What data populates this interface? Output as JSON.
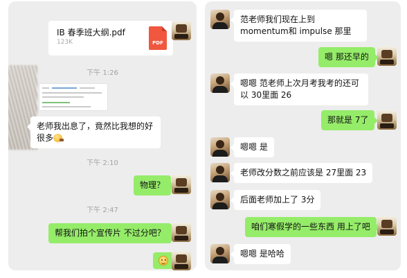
{
  "left_chat": {
    "file_card": {
      "name": "IB 春季班大纲.pdf",
      "size": "123K",
      "icon_label": "PDF"
    },
    "timestamps": [
      "下午 1:26",
      "下午 2:10",
      "下午 2:47"
    ],
    "messages": [
      {
        "sender": "teacher",
        "text": "老师我出息了，竟然比我想的好很多"
      },
      {
        "sender": "me",
        "text": "物理？"
      },
      {
        "sender": "me",
        "text": "帮我们拍个宣传片 不过分吧？"
      },
      {
        "sender": "me",
        "emoji": "smiley-emoji"
      }
    ]
  },
  "right_chat": {
    "messages": [
      {
        "sender": "teacher",
        "text": "范老师我们现在上到 momentum和 impulse 那里"
      },
      {
        "sender": "me",
        "text": "嗯 那还早的"
      },
      {
        "sender": "teacher",
        "text": "嗯嗯 范老师上次月考我考的还可以 30里面 26"
      },
      {
        "sender": "me",
        "text": "那就是 7了"
      },
      {
        "sender": "teacher",
        "text": "嗯嗯 是"
      },
      {
        "sender": "teacher",
        "text": "老师改分数之前应该是 27里面 23"
      },
      {
        "sender": "teacher",
        "text": "后面老师加上了 3分"
      },
      {
        "sender": "me",
        "text": "咱们寒假学的一些东西 用上了吧"
      },
      {
        "sender": "teacher",
        "text": "嗯嗯 是哈哈"
      }
    ]
  },
  "colors": {
    "chat_background": "#ededed",
    "incoming_bubble": "#ffffff",
    "outgoing_bubble": "#95ec69",
    "timestamp_text": "#a2a2a2",
    "pdf_icon": "#f0573e"
  }
}
